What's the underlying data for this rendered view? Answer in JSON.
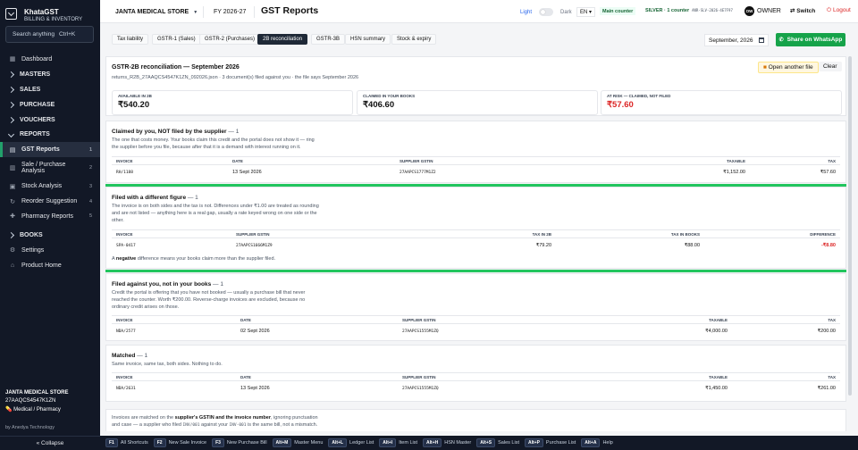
{
  "brand": {
    "name": "KhataGST",
    "subtitle": "BILLING & INVENTORY"
  },
  "search": {
    "placeholder": "Search anything",
    "shortcut": "Ctrl+K"
  },
  "nav": {
    "dashboard": "Dashboard",
    "masters": "MASTERS",
    "sales": "SALES",
    "purchase": "PURCHASE",
    "vouchers": "VOUCHERS",
    "reports": "REPORTS",
    "gst_reports": "GST Reports",
    "gst_reports_count": "1",
    "sale_purchase": "Sale / Purchase Analysis",
    "sale_purchase_count": "2",
    "stock_analysis": "Stock Analysis",
    "stock_analysis_count": "3",
    "reorder": "Reorder Suggestion",
    "reorder_count": "4",
    "pharmacy": "Pharmacy Reports",
    "pharmacy_count": "5",
    "books": "BOOKS",
    "settings": "Settings",
    "product_home": "Product Home"
  },
  "shop": {
    "name": "JANTA MEDICAL STORE",
    "gstin": "27AAQCS4547K1ZN",
    "type": "Medical / Pharmacy"
  },
  "byline": "by Anedya Technology",
  "collapse": "« Collapse",
  "topbar": {
    "store": "JANTA MEDICAL STORE",
    "fy": "FY 2026-27",
    "title": "GST Reports",
    "light": "Light",
    "dark": "Dark",
    "lang": "EN",
    "counter": "Main counter",
    "plan": "SILVER · 1 counter",
    "plan_code": "ANR-SLV-2026-4E7F97",
    "owner_initials": "OW",
    "owner": "OWNER",
    "switch": "Switch",
    "logout": "Logout"
  },
  "tabs": [
    "Tax liability",
    "GSTR-1 (Sales)",
    "GSTR-2 (Purchases)",
    "2B reconciliation",
    "GSTR-3B",
    "HSN summary",
    "Stock & expiry"
  ],
  "active_tab": "2B reconciliation",
  "month": "September, 2026",
  "whatsapp": "Share on WhatsApp",
  "recon": {
    "title": "GSTR-2B reconciliation — September 2026",
    "file_info": "returns_R2B_27AAQCS4547K1ZN_092026.json · 3 document(s) filed against you · the file says September 2026",
    "open_file": "Open another file",
    "clear": "Clear",
    "stats": [
      {
        "label": "AVAILABLE IN 2B",
        "value": "₹540.20",
        "color": "#111111"
      },
      {
        "label": "CLAIMED IN YOUR BOOKS",
        "value": "₹406.60",
        "color": "#111111"
      },
      {
        "label": "AT RISK — CLAIMED, NOT FILED",
        "value": "₹57.60",
        "color": "#dc2626"
      }
    ]
  },
  "sections": {
    "not_filed": {
      "title": "Claimed by you, NOT filed by the supplier",
      "count": "— 1",
      "desc": [
        "The one that costs money. Your books claim this credit and the portal does not show it — ring",
        "the supplier before you file, because after that it is a demand with interest running on it."
      ],
      "cols": [
        "INVOICE",
        "DATE",
        "SUPPLIER GSTIN",
        "TAXABLE",
        "TAX"
      ],
      "rows": [
        [
          "RH/1188",
          "13 Sept 2026",
          "27AAPCS1777M1Z2",
          "₹1,152.00",
          "₹57.60"
        ]
      ]
    },
    "diff_figure": {
      "title": "Filed with a different figure",
      "count": "— 1",
      "desc": [
        "The invoice is on both sides and the tax is not. Differences under ₹1.00 are treated as rounding",
        "and are not listed — anything here is a real gap, usually a rate keyed wrong on one side or the",
        "other."
      ],
      "cols": [
        "INVOICE",
        "SUPPLIER GSTIN",
        "TAX IN 2B",
        "TAX IN BOOKS",
        "DIFFERENCE"
      ],
      "rows": [
        [
          "SPA-0417",
          "27AAPCS1666M1Z9",
          "₹79.20",
          "₹88.00",
          "-₹8.80"
        ]
      ],
      "note_pre": "A",
      "note_bold": "negative",
      "note_post": "difference means your books claim more than the supplier filed."
    },
    "not_in_books": {
      "title": "Filed against you, not in your books",
      "count": "— 1",
      "desc": [
        "Credit the portal is offering that you have not booked — usually a purchase bill that never",
        "reached the counter. Worth ₹200.00. Reverse-charge invoices are excluded, because no",
        "ordinary credit arises on those."
      ],
      "cols": [
        "INVOICE",
        "DATE",
        "SUPPLIER GSTIN",
        "TAXABLE",
        "TAX"
      ],
      "rows": [
        [
          "NDA/2577",
          "02 Sept 2026",
          "27AAPCS1555M1ZQ",
          "₹4,000.00",
          "₹200.00"
        ]
      ]
    },
    "matched": {
      "title": "Matched",
      "count": "— 1",
      "desc": [
        "Same invoice, same tax, both sides. Nothing to do."
      ],
      "cols": [
        "INVOICE",
        "DATE",
        "SUPPLIER GSTIN",
        "TAXABLE",
        "TAX"
      ],
      "rows": [
        [
          "NDA/2631",
          "13 Sept 2026",
          "27AAPCS1555M1ZQ",
          "₹1,450.00",
          "₹261.00"
        ]
      ]
    }
  },
  "footnote": {
    "l1_pre": "Invoices are matched on the",
    "l1_bold": "supplier's GSTIN and the invoice number",
    "l1_post": ", ignoring punctuation",
    "l2_pre": "and case — a supplier who filed",
    "l2_code1": "INV/001",
    "l2_mid": "against your",
    "l2_code2": "INV-001",
    "l2_post": "is the same bill, not a mismatch."
  },
  "shortcuts": [
    {
      "key": "F1",
      "label": "All Shortcuts"
    },
    {
      "key": "F2",
      "label": "New Sale Invoice"
    },
    {
      "key": "F3",
      "label": "New Purchase Bill"
    },
    {
      "key": "Alt+M",
      "label": "Master Menu"
    },
    {
      "key": "Alt+L",
      "label": "Ledger List"
    },
    {
      "key": "Alt+I",
      "label": "Item List"
    },
    {
      "key": "Alt+H",
      "label": "HSN Master"
    },
    {
      "key": "Alt+S",
      "label": "Sales List"
    },
    {
      "key": "Alt+P",
      "label": "Purchase List"
    },
    {
      "key": "Alt+A",
      "label": "Help"
    }
  ]
}
